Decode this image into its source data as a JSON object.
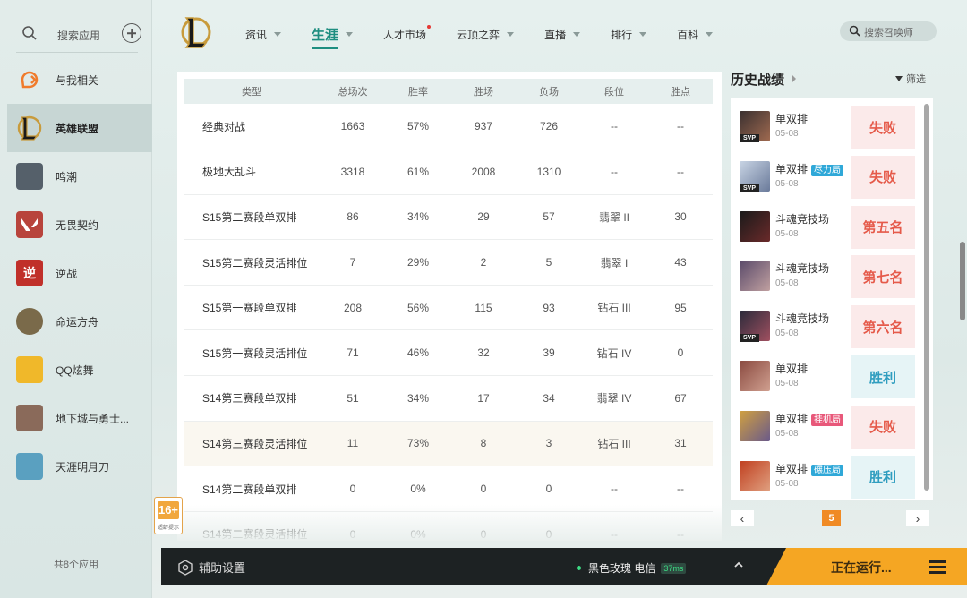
{
  "sidebar": {
    "search_label": "搜索应用",
    "apps": [
      {
        "name": "与我相关",
        "icon": "bell-icon",
        "color": "#f07b2c"
      },
      {
        "name": "英雄联盟",
        "icon": "lol-icon",
        "color": "#1a1a1a",
        "active": true
      },
      {
        "name": "鸣潮",
        "icon": "wuthering-icon",
        "color": "#55606a"
      },
      {
        "name": "无畏契约",
        "icon": "valorant-icon",
        "color": "#b8443c"
      },
      {
        "name": "逆战",
        "icon": "nizhan-icon",
        "color": "#c0302a"
      },
      {
        "name": "命运方舟",
        "icon": "lostark-icon",
        "color": "#7a6a4a"
      },
      {
        "name": "QQ炫舞",
        "icon": "qqdance-icon",
        "color": "#f0b82a"
      },
      {
        "name": "地下城与勇士...",
        "icon": "dnf-icon",
        "color": "#8a6a5a"
      },
      {
        "name": "天涯明月刀",
        "icon": "tianya-icon",
        "color": "#5aa0c0"
      }
    ],
    "app_count": "共8个应用"
  },
  "nav": {
    "items": [
      {
        "label": "资讯",
        "caret": true
      },
      {
        "label": "生涯",
        "caret": true,
        "active": true
      },
      {
        "label": "人才市场",
        "caret": false,
        "dot": true
      },
      {
        "label": "云顶之弈",
        "caret": true
      },
      {
        "label": "直播",
        "caret": true
      },
      {
        "label": "排行",
        "caret": true
      },
      {
        "label": "百科",
        "caret": true
      }
    ],
    "search_placeholder": "搜索召唤师"
  },
  "table": {
    "headers": [
      "类型",
      "总场次",
      "胜率",
      "胜场",
      "负场",
      "段位",
      "胜点"
    ],
    "rows": [
      [
        "经典对战",
        "1663",
        "57%",
        "937",
        "726",
        "--",
        "--"
      ],
      [
        "极地大乱斗",
        "3318",
        "61%",
        "2008",
        "1310",
        "--",
        "--"
      ],
      [
        "S15第二赛段单双排",
        "86",
        "34%",
        "29",
        "57",
        "翡翠 II",
        "30"
      ],
      [
        "S15第二赛段灵活排位",
        "7",
        "29%",
        "2",
        "5",
        "翡翠 I",
        "43"
      ],
      [
        "S15第一赛段单双排",
        "208",
        "56%",
        "115",
        "93",
        "钻石 III",
        "95"
      ],
      [
        "S15第一赛段灵活排位",
        "71",
        "46%",
        "32",
        "39",
        "钻石 IV",
        "0"
      ],
      [
        "S14第三赛段单双排",
        "51",
        "34%",
        "17",
        "34",
        "翡翠 IV",
        "67"
      ],
      [
        "S14第三赛段灵活排位",
        "11",
        "73%",
        "8",
        "3",
        "钻石 III",
        "31"
      ],
      [
        "S14第二赛段单双排",
        "0",
        "0%",
        "0",
        "0",
        "--",
        "--"
      ],
      [
        "S14第二赛段灵活排位",
        "0",
        "0%",
        "0",
        "0",
        "--",
        "--"
      ]
    ],
    "highlight_row": 7
  },
  "age_badge": {
    "num": "16+",
    "sub": "适龄提示"
  },
  "history": {
    "title": "历史战绩",
    "filter": "筛选",
    "items": [
      {
        "mode": "单双排",
        "tag": "",
        "date": "05-08",
        "result": "失败",
        "type": "lose",
        "svp": true,
        "c1": "#3a3030",
        "c2": "#a06a50"
      },
      {
        "mode": "单双排",
        "tag": "尽力局",
        "tag_color": "#2fa8d8",
        "date": "05-08",
        "result": "失败",
        "type": "lose",
        "svp": true,
        "c1": "#c8d4e4",
        "c2": "#6a7a9a"
      },
      {
        "mode": "斗魂竞技场",
        "tag": "",
        "date": "05-08",
        "result": "第五名",
        "type": "lose",
        "svp": false,
        "c1": "#1a1a1a",
        "c2": "#6a2a2a"
      },
      {
        "mode": "斗魂竞技场",
        "tag": "",
        "date": "05-08",
        "result": "第七名",
        "type": "lose",
        "svp": false,
        "c1": "#5a4a6a",
        "c2": "#c0a0a0"
      },
      {
        "mode": "斗魂竞技场",
        "tag": "",
        "date": "05-08",
        "result": "第六名",
        "type": "lose",
        "svp": true,
        "c1": "#2a2a3a",
        "c2": "#a05060"
      },
      {
        "mode": "单双排",
        "tag": "",
        "date": "05-08",
        "result": "胜利",
        "type": "win",
        "svp": false,
        "c1": "#8a4a40",
        "c2": "#d0a090"
      },
      {
        "mode": "单双排",
        "tag": "挂机局",
        "tag_color": "#e8587a",
        "date": "05-08",
        "result": "失败",
        "type": "lose",
        "svp": false,
        "c1": "#d0a040",
        "c2": "#6a5a8a"
      },
      {
        "mode": "单双排",
        "tag": "碾压局",
        "tag_color": "#2fa8d8",
        "date": "05-08",
        "result": "胜利",
        "type": "win",
        "svp": false,
        "c1": "#c04020",
        "c2": "#e0a080"
      }
    ],
    "page": "5"
  },
  "bottombar": {
    "assist_label": "辅助设置",
    "server": "黑色玫瑰 电信",
    "ping": "37ms",
    "running": "正在运行..."
  }
}
